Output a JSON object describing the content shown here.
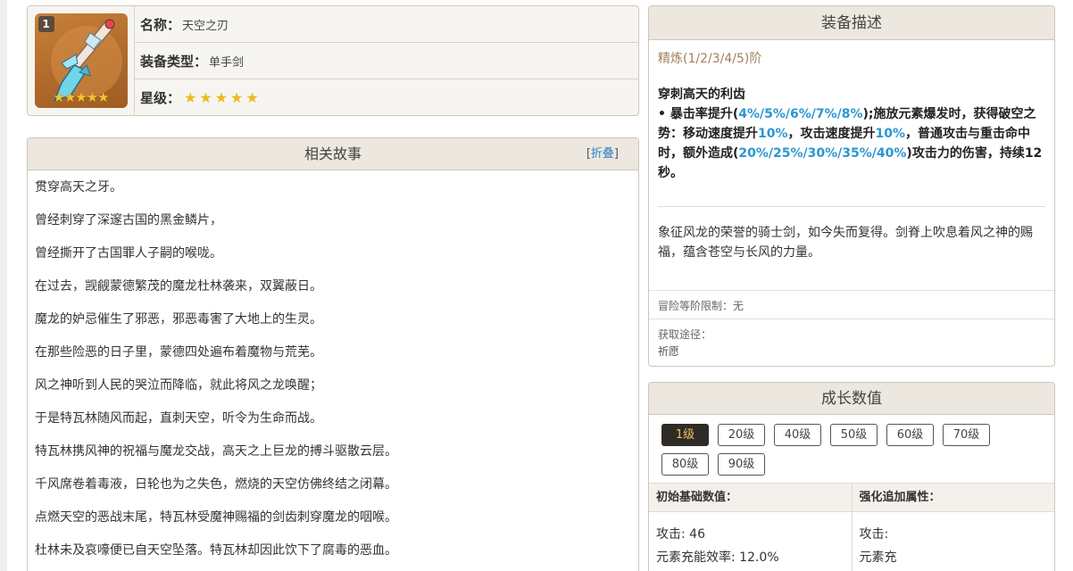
{
  "weapon": {
    "rank_badge": "1",
    "name_label": "名称：",
    "name": "天空之刃",
    "type_label": "装备类型：",
    "type": "单手剑",
    "rarity_label": "星级：",
    "stars": 5
  },
  "story": {
    "title": "相关故事",
    "collapse_prefix": "[",
    "collapse_label": "折叠",
    "collapse_suffix": "]",
    "lines": [
      "贯穿高天之牙。",
      "曾经刺穿了深邃古国的黑金鳞片，",
      "曾经撕开了古国罪人子嗣的喉咙。",
      "在过去，觊觎蒙德繁茂的魔龙杜林袭来，双翼蔽日。",
      "魔龙的妒忌催生了邪恶，邪恶毒害了大地上的生灵。",
      "在那些险恶的日子里，蒙德四处遍布着魔物与荒芜。",
      "风之神听到人民的哭泣而降临，就此将风之龙唤醒；",
      "于是特瓦林随风而起，直刺天空，听令为生命而战。",
      "特瓦林携风神的祝福与魔龙交战，高天之上巨龙的搏斗驱散云层。",
      "千风席卷着毒液，日轮也为之失色，燃烧的天空仿佛终结之闭幕。",
      "点燃天空的恶战末尾，特瓦林受魔神赐福的剑齿刺穿魔龙的咽喉。",
      "杜林未及哀嚎便已自天空坠落。特瓦林却因此饮下了腐毒的恶血。"
    ]
  },
  "description": {
    "title": "装备描述",
    "refine": "精炼(1/2/3/4/5)阶",
    "skill_name": "穿刺高天的利齿",
    "skill_p1": "• 暴击率提升(",
    "skill_v1": "4%/5%/6%/7%/8%",
    "skill_p2": ");施放元素爆发时，获得破空之势：移动速度提升",
    "skill_v2": "10%",
    "skill_p3": "，攻击速度提升",
    "skill_v3": "10%",
    "skill_p4": "，普通攻击与重击命中时，额外造成(",
    "skill_v4": "20%/25%/30%/35%/40%",
    "skill_p5": ")攻击力的伤害，持续12秒。",
    "lore": "象征风龙的荣誉的骑士剑，如今失而复得。剑脊上吹息着风之神的赐福，蕴含苍空与长风的力量。",
    "level_limit": "冒险等阶限制：无",
    "obtain_label": "获取途径：",
    "obtain_value": "祈愿"
  },
  "growth": {
    "title": "成长数值",
    "levels": [
      "1级",
      "20级",
      "40级",
      "50级",
      "60级",
      "70级",
      "80级",
      "90级"
    ],
    "active_level": "1级",
    "base_header": "初始基础数值：",
    "bonus_header": "强化追加属性：",
    "base_stats": [
      "攻击: 46",
      "元素充能效率: 12.0%"
    ],
    "bonus_stats": [
      "攻击:",
      "元素充"
    ]
  },
  "colors": {
    "highlight": "#2a97d2",
    "refine": "#a0825c",
    "header_bg": "#ece7df",
    "active_btn": "#2f2b26",
    "star": "#f0b71f"
  }
}
